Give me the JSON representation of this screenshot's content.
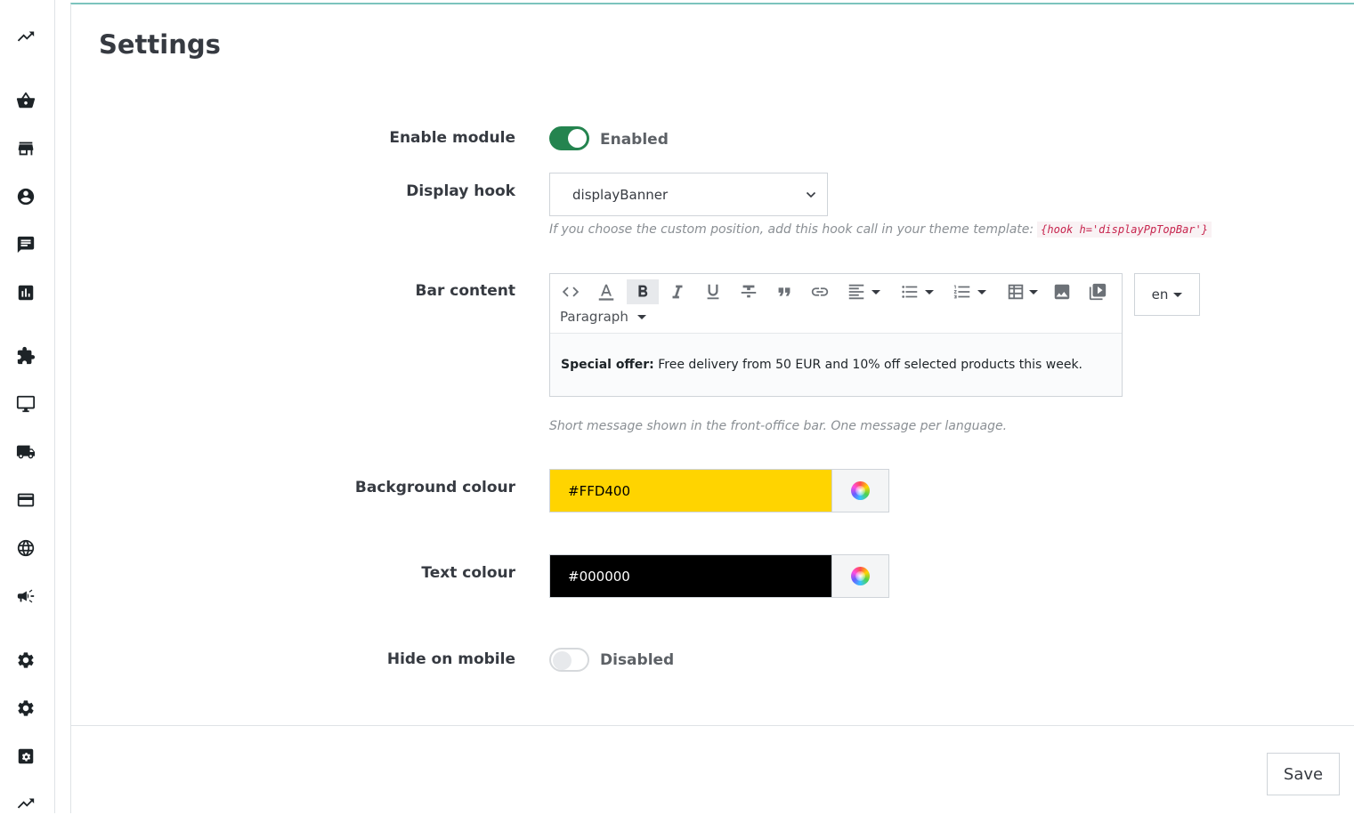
{
  "sidebar": {
    "icons": [
      "trending-up-icon",
      "basket-icon",
      "store-icon",
      "user-icon",
      "chat-icon",
      "stats-icon",
      "puzzle-icon",
      "desktop-icon",
      "truck-icon",
      "card-icon",
      "globe-icon",
      "megaphone-icon",
      "gear-icon",
      "gear-icon",
      "settings-box-icon",
      "trending-up-icon"
    ]
  },
  "panel": {
    "title": "Settings"
  },
  "fields": {
    "enable_module": {
      "label": "Enable module",
      "state_text": "Enabled",
      "value": true
    },
    "display_hook": {
      "label": "Display hook",
      "selected": "displayBanner",
      "help": "If you choose the custom position, add this hook call in your theme template:",
      "code": "{hook h='displayPpTopBar'}"
    },
    "bar_content": {
      "label": "Bar content",
      "format": "Paragraph",
      "content_bold": "Special offer:",
      "content_text": " Free delivery from 50 EUR and 10% off selected products this week.",
      "help": "Short message shown in the front-office bar. One message per language.",
      "language": "en"
    },
    "background_colour": {
      "label": "Background colour",
      "value": "#FFD400",
      "color": "#FFD400"
    },
    "text_colour": {
      "label": "Text colour",
      "value": "#000000",
      "color": "#000000"
    },
    "hide_on_mobile": {
      "label": "Hide on mobile",
      "state_text": "Disabled",
      "value": false
    }
  },
  "footer": {
    "save_label": "Save"
  },
  "colors": {
    "accent_green": "#24844f",
    "panel_top_border": "#7cc4bd",
    "code_color": "#c7254e"
  }
}
